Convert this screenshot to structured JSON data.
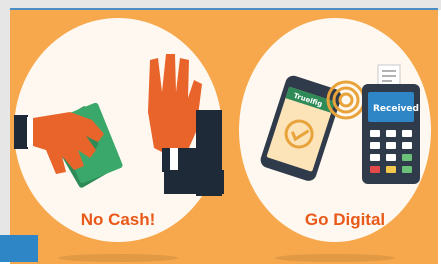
{
  "captions": {
    "left": "No Cash!",
    "right": "Go Digital"
  },
  "phone": {
    "app_name": "Truelfig"
  },
  "pos_terminal": {
    "screen_text": "Received"
  },
  "colors": {
    "background": "#F7A84D",
    "circle": "#FFF8F0",
    "caption": "#E8591A",
    "accent_green": "#2E8B57",
    "terminal_body": "#2F3A4A",
    "terminal_screen": "#2E86C6"
  }
}
